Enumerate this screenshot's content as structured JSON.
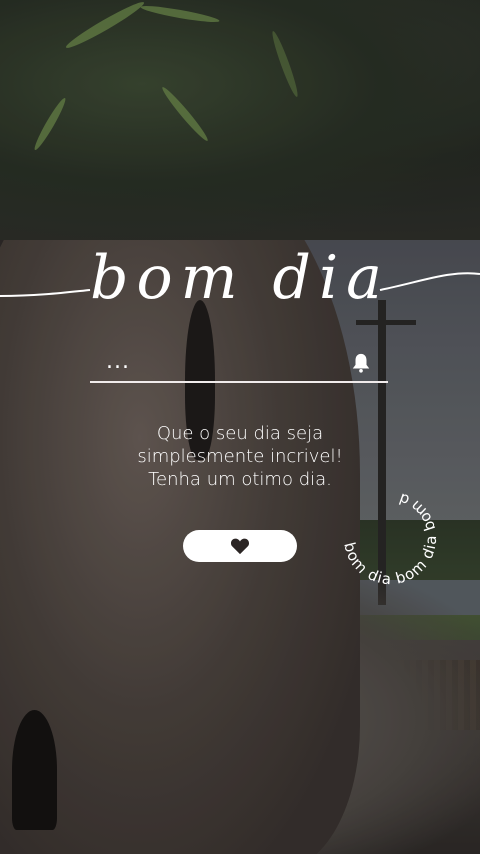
{
  "story": {
    "title": "bom dia",
    "decorative_dots": "...",
    "message_lines": [
      "Que o seu dia seja",
      "simplesmente incrivel!",
      "Tenha um otimo dia."
    ],
    "reaction_button": {
      "icon": "heart-icon"
    },
    "circular_stamp_text": "bom dia bom dia bom d",
    "bell_icon": "bell-icon"
  },
  "colors": {
    "text": "#ffffff",
    "button_bg": "#ffffff",
    "heart": "#2b2524"
  }
}
